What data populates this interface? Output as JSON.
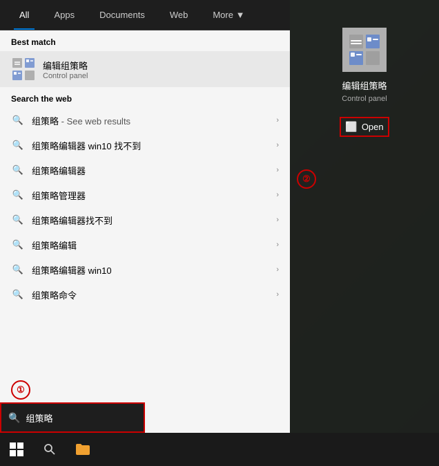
{
  "nav": {
    "tabs": [
      {
        "label": "All",
        "active": true
      },
      {
        "label": "Apps",
        "active": false
      },
      {
        "label": "Documents",
        "active": false
      },
      {
        "label": "Web",
        "active": false
      },
      {
        "label": "More ▼",
        "active": false
      }
    ]
  },
  "best_match": {
    "section_label": "Best match",
    "item_title": "编辑组策略",
    "item_subtitle": "Control panel"
  },
  "search_web": {
    "section_label": "Search the web",
    "items": [
      {
        "text": "组策略",
        "suffix": " - See web results"
      },
      {
        "text": "组策略编辑器 win10 找不到"
      },
      {
        "text": "组策略编辑器"
      },
      {
        "text": "组策略管理器"
      },
      {
        "text": "组策略编辑器找不到"
      },
      {
        "text": "组策略编辑"
      },
      {
        "text": "组策略编辑器 win10"
      },
      {
        "text": "组策略命令"
      }
    ]
  },
  "right_panel": {
    "title": "编辑组策略",
    "subtitle": "Control panel",
    "open_label": "Open"
  },
  "search_bar": {
    "placeholder": "组策略",
    "icon": "🔍"
  },
  "taskbar": {
    "start_icon": "windows",
    "search_icon": "search",
    "folder_icon": "folder"
  },
  "annotations": {
    "circle1": "①",
    "circle2": "②"
  }
}
